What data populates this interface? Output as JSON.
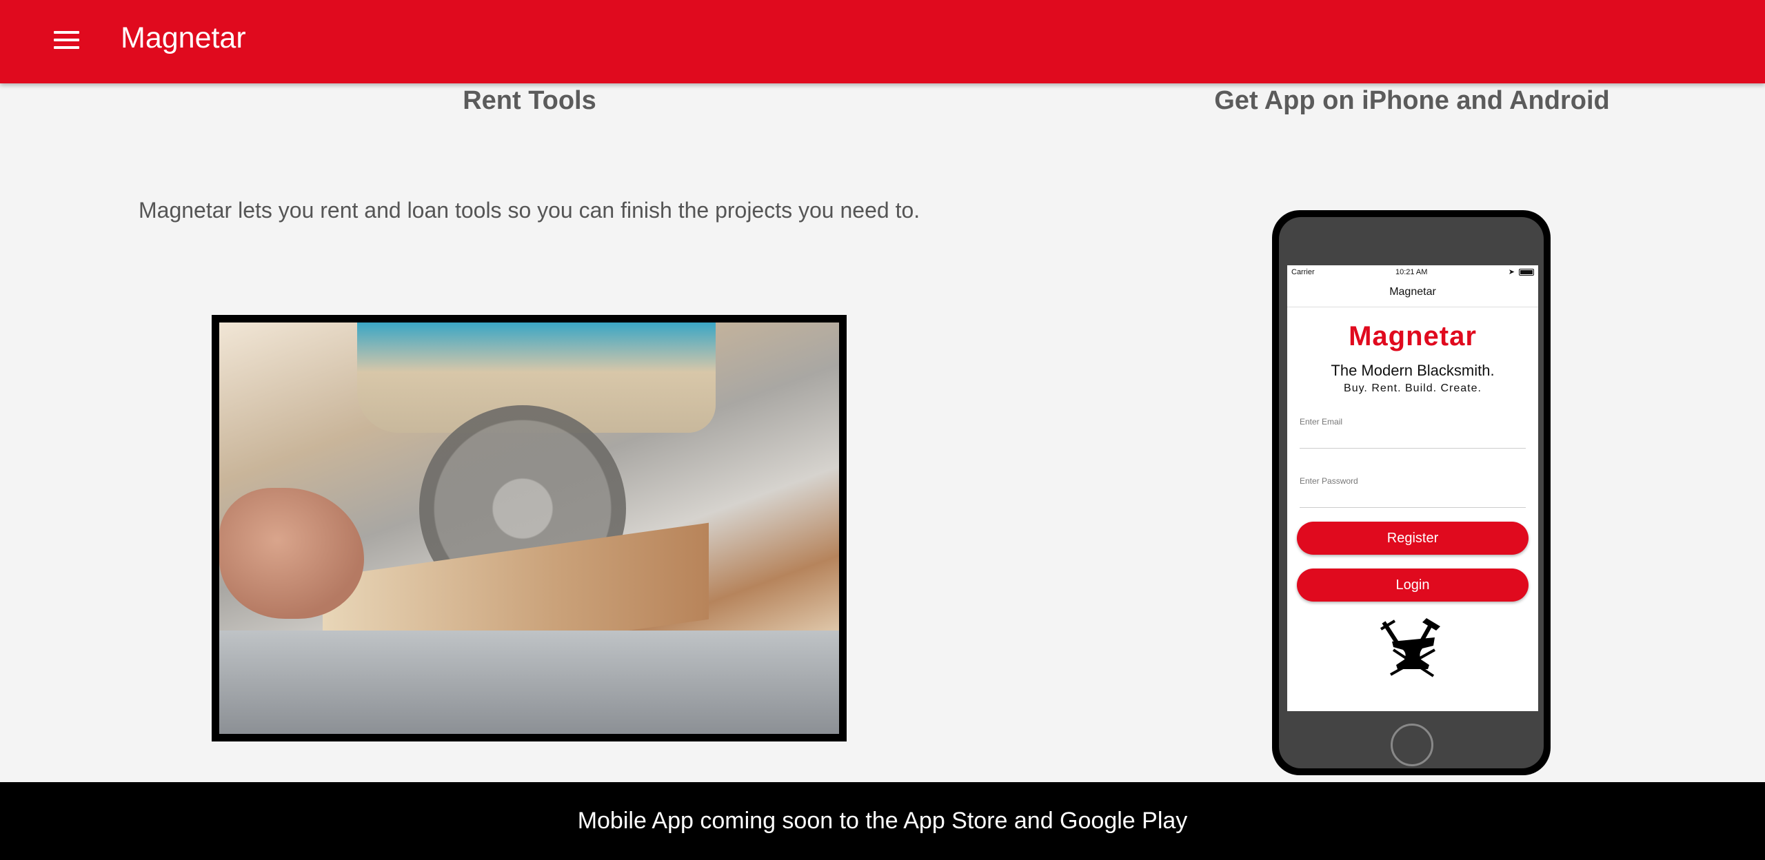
{
  "appbar": {
    "title": "Magnetar",
    "menu_icon": "menu-icon"
  },
  "left": {
    "heading": "Rent Tools",
    "description": "Magnetar lets you rent and loan tools so you can finish the projects you need to.",
    "image_icon": "saw-photo"
  },
  "right": {
    "heading": "Get App on iPhone and Android",
    "phone": {
      "status": {
        "carrier": "Carrier",
        "time": "10:21 AM"
      },
      "nav_title": "Magnetar",
      "logo": "Magnetar",
      "tagline": "The Modern Blacksmith.",
      "subtagline": "Buy. Rent. Build. Create.",
      "email_label": "Enter Email",
      "password_label": "Enter Password",
      "register_label": "Register",
      "login_label": "Login",
      "anvil_icon": "anvil-icon"
    }
  },
  "footer": {
    "text": "Mobile App coming soon to the App Store and Google Play"
  },
  "colors": {
    "brand": "#e00a1e",
    "footer": "#000000",
    "background": "#f4f4f4"
  }
}
